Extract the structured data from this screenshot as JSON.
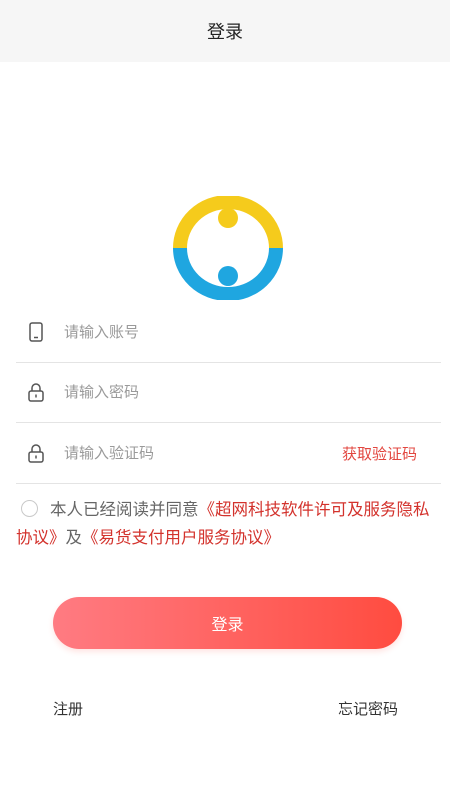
{
  "header": {
    "title": "登录"
  },
  "form": {
    "account_placeholder": "请输入账号",
    "password_placeholder": "请输入密码",
    "code_placeholder": "请输入验证码",
    "get_code_label": "获取验证码"
  },
  "agreement": {
    "prefix": "本人已经阅读并同意",
    "link1": "《超网科技软件许可及服务隐私协议》",
    "middle": "及",
    "link2": "《易货支付用户服务协议》"
  },
  "login_label": "登录",
  "register_label": "注册",
  "forgot_label": "忘记密码",
  "colors": {
    "accent": "#e2463f",
    "logo_yellow": "#f5cb1c",
    "logo_blue": "#1fa6e0",
    "button_gradient_start": "#ff7b82",
    "button_gradient_end": "#ff4c40"
  },
  "icons": [
    "phone-icon",
    "lock-icon",
    "lock-icon",
    "radio-unchecked-icon",
    "app-logo"
  ]
}
